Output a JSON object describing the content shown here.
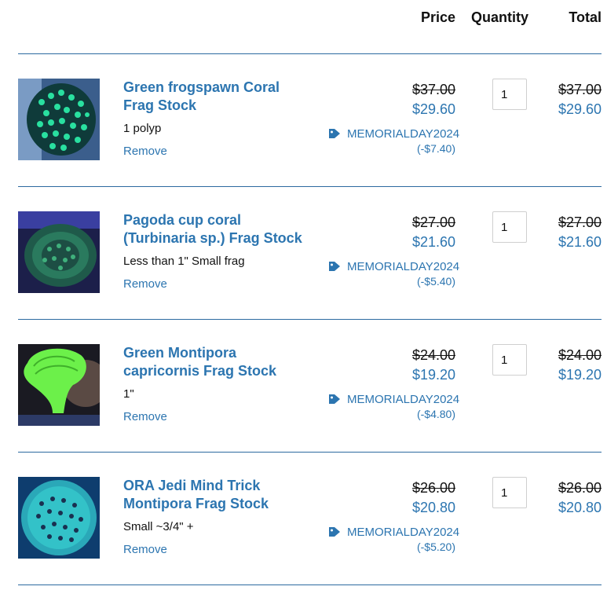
{
  "header": {
    "price_label": "Price",
    "quantity_label": "Quantity",
    "total_label": "Total"
  },
  "colors": {
    "link": "#2c75b0",
    "divider": "#2c6aa0",
    "text": "#111111"
  },
  "items": [
    {
      "title": "Green frogspawn Coral Frag Stock",
      "variant": "1 polyp",
      "remove_label": "Remove",
      "original_price": "$37.00",
      "sale_price": "$29.60",
      "discount_code": "MEMORIALDAY2024",
      "discount_amount": "(-$7.40)",
      "quantity": "1",
      "total_original": "$37.00",
      "total_sale": "$29.60",
      "image_icon": "frogspawn-coral-photo"
    },
    {
      "title": "Pagoda cup coral (Turbinaria sp.) Frag Stock",
      "variant": "Less than 1\" Small frag",
      "remove_label": "Remove",
      "original_price": "$27.00",
      "sale_price": "$21.60",
      "discount_code": "MEMORIALDAY2024",
      "discount_amount": "(-$5.40)",
      "quantity": "1",
      "total_original": "$27.00",
      "total_sale": "$21.60",
      "image_icon": "pagoda-coral-photo"
    },
    {
      "title": "Green Montipora capricornis Frag Stock",
      "variant": "1\"",
      "remove_label": "Remove",
      "original_price": "$24.00",
      "sale_price": "$19.20",
      "discount_code": "MEMORIALDAY2024",
      "discount_amount": "(-$4.80)",
      "quantity": "1",
      "total_original": "$24.00",
      "total_sale": "$19.20",
      "image_icon": "montipora-capricornis-photo"
    },
    {
      "title": "ORA Jedi Mind Trick Montipora Frag Stock",
      "variant": "Small ~3/4\" +",
      "remove_label": "Remove",
      "original_price": "$26.00",
      "sale_price": "$20.80",
      "discount_code": "MEMORIALDAY2024",
      "discount_amount": "(-$5.20)",
      "quantity": "1",
      "total_original": "$26.00",
      "total_sale": "$20.80",
      "image_icon": "jedi-mind-trick-photo"
    }
  ]
}
